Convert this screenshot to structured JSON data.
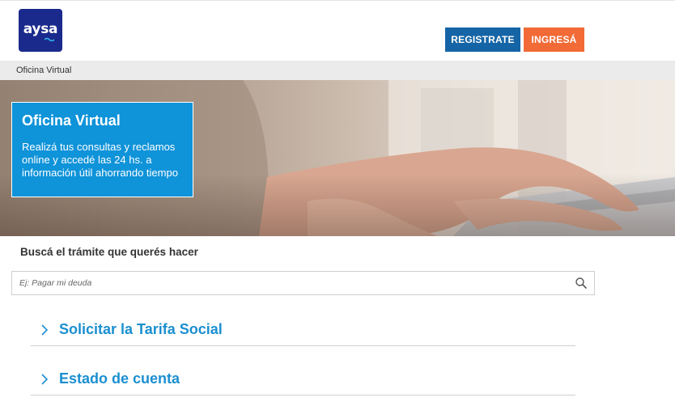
{
  "header": {
    "logo_text": "aysa",
    "register_label": "REGISTRATE",
    "login_label": "INGRESÁ"
  },
  "breadcrumb": {
    "current": "Oficina Virtual"
  },
  "hero": {
    "title": "Oficina Virtual",
    "text": "Realizá tus consultas y reclamos online y accedé las 24 hs. a información útil ahorrando tiempo"
  },
  "search": {
    "heading": "Buscá el trámite que querés hacer",
    "placeholder": "Ej: Pagar mi deuda"
  },
  "procedures": [
    {
      "label": "Solicitar la Tarifa Social"
    },
    {
      "label": "Estado de cuenta"
    }
  ],
  "colors": {
    "brand_navy": "#1a2a8c",
    "register_blue": "#1565a6",
    "login_orange": "#f26a36",
    "hero_card_blue": "#0f93d9",
    "link_blue": "#1b8fd0"
  },
  "icons": {
    "search": "magnifier",
    "chevron": "chevron-right"
  }
}
